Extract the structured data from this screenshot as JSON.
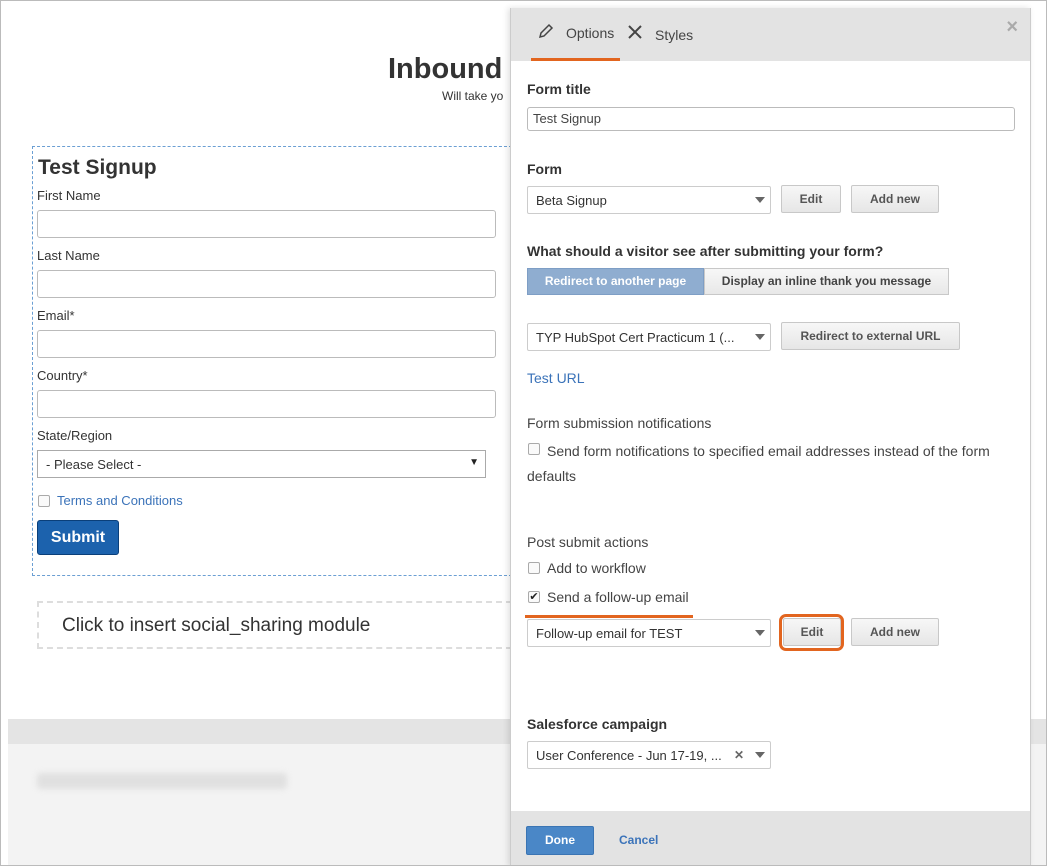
{
  "background": {
    "page_title": "Inbound",
    "page_subtitle": "Will take yo",
    "form": {
      "title": "Test Signup",
      "fields": [
        {
          "label": "First Name"
        },
        {
          "label": "Last Name"
        },
        {
          "label": "Email*"
        },
        {
          "label": "Country*"
        }
      ],
      "state_label": "State/Region",
      "state_select_value": "- Please Select -",
      "terms_label": "Terms and Conditions",
      "submit_label": "Submit"
    },
    "social_module_text": "Click to insert social_sharing module"
  },
  "panel": {
    "tabs": [
      {
        "label": "Options",
        "icon": "pencil-icon",
        "active": true
      },
      {
        "label": "Styles",
        "icon": "brush-icon",
        "active": false
      }
    ],
    "close_icon": "×",
    "form_title_heading": "Form title",
    "form_title_value": "Test Signup",
    "form_heading": "Form",
    "form_select_value": "Beta Signup",
    "form_edit_label": "Edit",
    "form_add_new_label": "Add new",
    "after_submit_heading": "What should a visitor see after submitting your form?",
    "redirect_option": "Redirect to another page",
    "inline_option": "Display an inline thank you message",
    "redirect_page_value": "TYP HubSpot Cert Practicum 1 (...",
    "redirect_external_label": "Redirect to external URL",
    "test_url_label": "Test URL",
    "notifications_heading": "Form submission notifications",
    "notifications_checkbox_text": "Send form notifications to specified email addresses instead of the form defaults",
    "post_submit_heading": "Post submit actions",
    "add_workflow_label": "Add to workflow",
    "send_followup_label": "Send a follow-up email",
    "followup_select_value": "Follow-up email for TEST",
    "followup_edit_label": "Edit",
    "followup_add_new_label": "Add new",
    "salesforce_heading": "Salesforce campaign",
    "salesforce_select_value": "User Conference - Jun 17-19, ...",
    "done_label": "Done",
    "cancel_label": "Cancel",
    "accent_color": "#e2651f",
    "link_color": "#3b73b9"
  }
}
